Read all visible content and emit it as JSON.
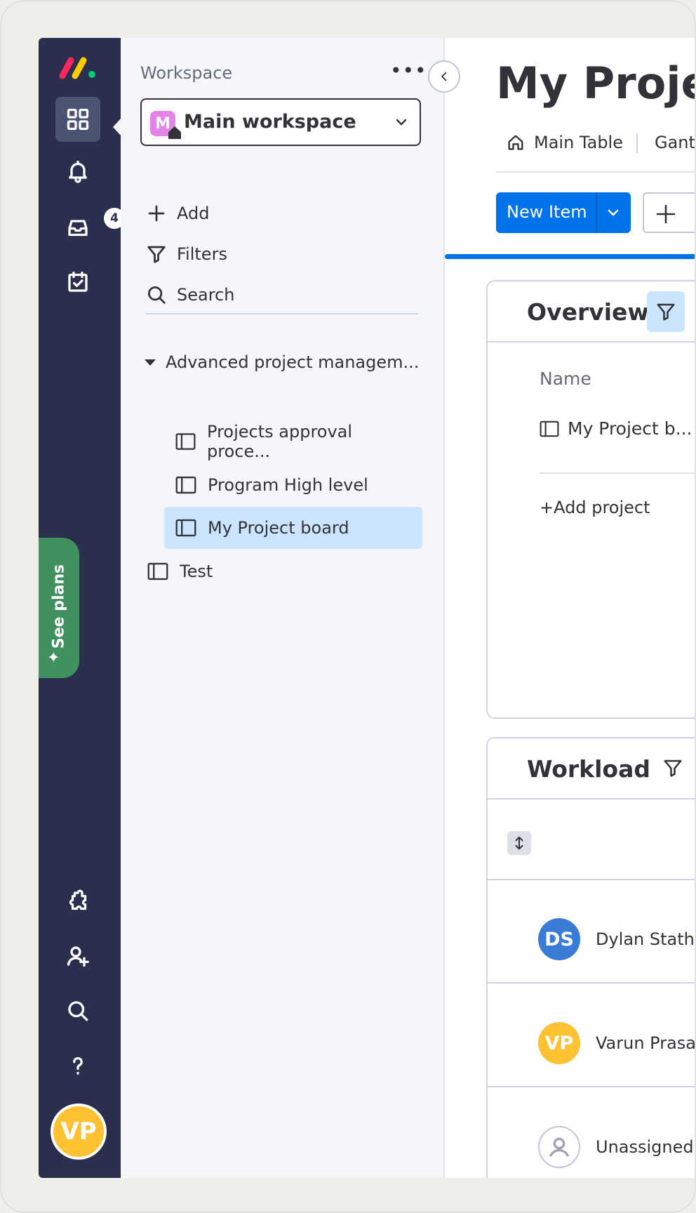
{
  "rail": {
    "inbox_badge": "4",
    "see_plans": "See plans",
    "user_initials": "VP",
    "user_color": "#fdc131",
    "icons": [
      "logo-icon",
      "grid-icon",
      "bell-icon",
      "inbox-icon",
      "calendar-check-icon",
      "puzzle-icon",
      "invite-user-icon",
      "search-icon",
      "help-icon"
    ]
  },
  "panel": {
    "label": "Workspace",
    "more": "•••",
    "workspace": {
      "initial": "M",
      "name": "Main workspace",
      "color": "#e484e7"
    },
    "actions": [
      {
        "label": "Add",
        "icon": "plus-icon"
      },
      {
        "label": "Filters",
        "icon": "filter-icon"
      },
      {
        "label": "Search",
        "icon": "search-icon"
      }
    ],
    "folder": "Advanced project managem...",
    "boards": [
      {
        "label": "Projects approval proce..."
      },
      {
        "label": "Program High level"
      },
      {
        "label": "My Project board",
        "selected": true
      }
    ],
    "standalone_board": "Test"
  },
  "main": {
    "title": "My Project",
    "tabs": [
      {
        "label": "Main Table",
        "icon": "home-icon"
      },
      {
        "label": "Gantt"
      }
    ],
    "new_item_label": "New Item",
    "accent": "#0073ea",
    "overview": {
      "title": "Overview",
      "column_header": "Name",
      "row": "My Project b...",
      "add": "+Add project"
    },
    "workload": {
      "title": "Workload",
      "people": [
        {
          "initials": "DS",
          "name": "Dylan Statham",
          "color": "#3a7bd5"
        },
        {
          "initials": "VP",
          "name": "Varun Prasad",
          "color": "#fdc131"
        },
        {
          "initials": "",
          "name": "Unassigned",
          "color": "#ffffff"
        }
      ]
    }
  }
}
